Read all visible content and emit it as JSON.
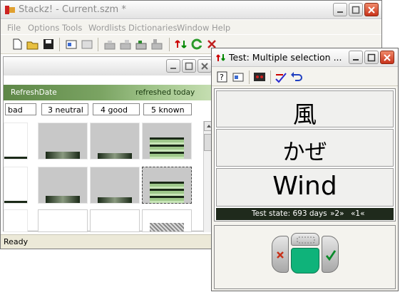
{
  "main_window": {
    "title": "Stackz! - Current.szm *",
    "menu": [
      "File",
      "Options",
      "Tools",
      "Wordlists",
      "Dictionaries",
      "Window",
      "Help"
    ],
    "status": "Ready"
  },
  "child_window": {
    "header_left": "RefreshDate",
    "header_right": "refreshed today",
    "categories": [
      "bad",
      "3 neutral",
      "4 good",
      "5 known"
    ]
  },
  "test_window": {
    "title": "Test: Multiple selection ...",
    "kanji": "風",
    "kana": "かぜ",
    "meaning": "Wind",
    "test_state": "Test state: 693 days",
    "nav_next": "»2»",
    "nav_prev": "«1«"
  },
  "colors": {
    "header_green": "#6a8f50",
    "state_bar": "#1f2a1c",
    "accept": "#0fb37a",
    "reject": "#c8321a"
  }
}
